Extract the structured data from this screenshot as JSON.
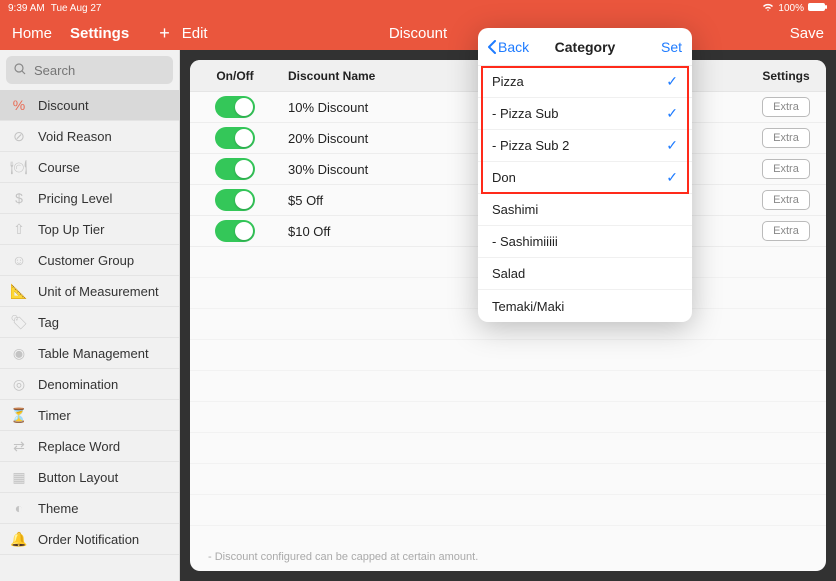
{
  "status": {
    "time": "9:39 AM",
    "date": "Tue Aug 27",
    "battery": "100%"
  },
  "nav": {
    "home": "Home",
    "settings": "Settings",
    "edit": "Edit",
    "title": "Discount",
    "save": "Save"
  },
  "search": {
    "placeholder": "Search"
  },
  "sidebar": {
    "items": [
      {
        "label": "Discount"
      },
      {
        "label": "Void Reason"
      },
      {
        "label": "Course"
      },
      {
        "label": "Pricing Level"
      },
      {
        "label": "Top Up Tier"
      },
      {
        "label": "Customer Group"
      },
      {
        "label": "Unit of Measurement"
      },
      {
        "label": "Tag"
      },
      {
        "label": "Table Management"
      },
      {
        "label": "Denomination"
      },
      {
        "label": "Timer"
      },
      {
        "label": "Replace Word"
      },
      {
        "label": "Button Layout"
      },
      {
        "label": "Theme"
      },
      {
        "label": "Order Notification"
      }
    ]
  },
  "table": {
    "headers": {
      "onoff": "On/Off",
      "name": "Discount Name",
      "settings": "Settings"
    },
    "rows": [
      {
        "on": true,
        "name": "10% Discount",
        "extra": "Extra"
      },
      {
        "on": true,
        "name": "20% Discount",
        "extra": "Extra"
      },
      {
        "on": true,
        "name": "30% Discount",
        "extra": "Extra"
      },
      {
        "on": true,
        "name": "$5 Off",
        "extra": "Extra"
      },
      {
        "on": true,
        "name": "$10 Off",
        "extra": "Extra"
      }
    ],
    "footnote": "- Discount configured can be capped at certain amount."
  },
  "popover": {
    "back": "Back",
    "title": "Category",
    "set": "Set",
    "items": [
      {
        "label": "Pizza",
        "checked": true
      },
      {
        "label": "- Pizza Sub",
        "checked": true
      },
      {
        "label": "- Pizza Sub 2",
        "checked": true
      },
      {
        "label": "Don",
        "checked": true
      },
      {
        "label": "Sashimi",
        "checked": false
      },
      {
        "label": "- Sashimiiiii",
        "checked": false
      },
      {
        "label": "Salad",
        "checked": false
      },
      {
        "label": "Temaki/Maki",
        "checked": false
      }
    ]
  }
}
